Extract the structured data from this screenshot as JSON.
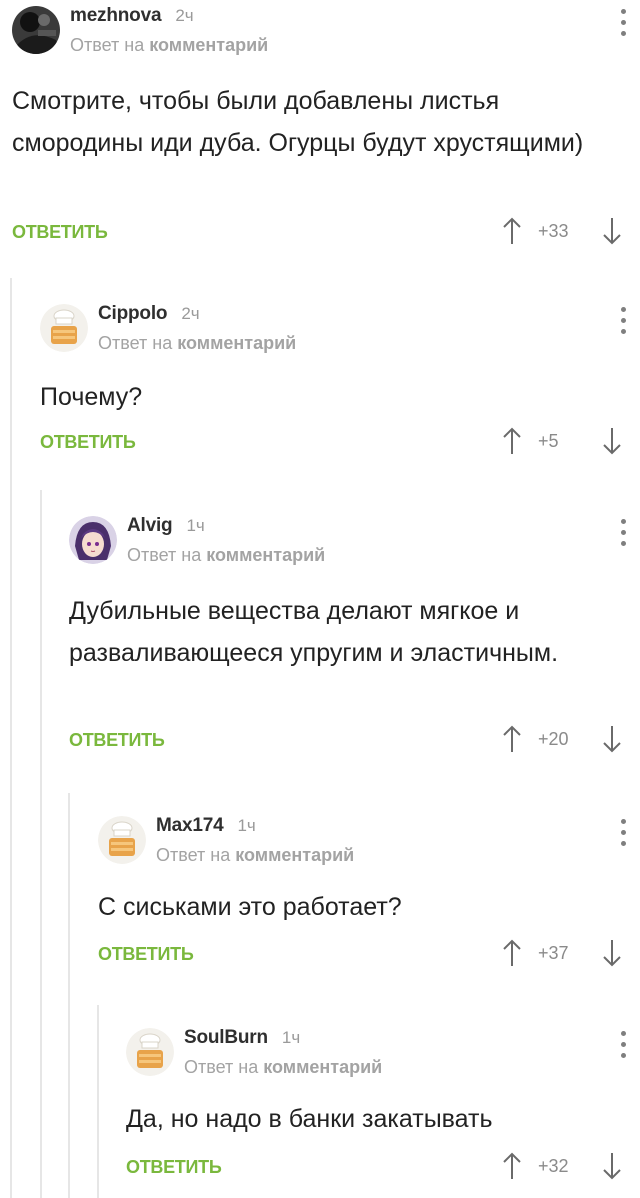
{
  "comments": [
    {
      "author": "mezhnova",
      "time": "2ч",
      "reply_prefix": "Ответ на",
      "reply_target": "комментарий",
      "text": "Смотрите, чтобы были добавлены листья смородины иди дуба. Огурцы будут хрустящими)",
      "reply_label": "ОТВЕТИТЬ",
      "score": "+33",
      "avatar": "dark-photo-avatar"
    },
    {
      "author": "Cippolo",
      "time": "2ч",
      "reply_prefix": "Ответ на",
      "reply_target": "комментарий",
      "text": "Почему?",
      "reply_label": "ОТВЕТИТЬ",
      "score": "+5",
      "avatar": "default-chef-avatar"
    },
    {
      "author": "Alvig",
      "time": "1ч",
      "reply_prefix": "Ответ на",
      "reply_target": "комментарий",
      "text": "Дубильные вещества делают мягкое и разваливающееся упругим и эластичным.",
      "reply_label": "ОТВЕТИТЬ",
      "score": "+20",
      "avatar": "anime-girl-avatar"
    },
    {
      "author": "Max174",
      "time": "1ч",
      "reply_prefix": "Ответ на",
      "reply_target": "комментарий",
      "text": "С сиськами это работает?",
      "reply_label": "ОТВЕТИТЬ",
      "score": "+37",
      "avatar": "default-chef-avatar"
    },
    {
      "author": "SoulBurn",
      "time": "1ч",
      "reply_prefix": "Ответ на",
      "reply_target": "комментарий",
      "text": "Да, но надо в банки закатывать",
      "reply_label": "ОТВЕТИТЬ",
      "score": "+32",
      "avatar": "default-chef-avatar"
    }
  ],
  "colors": {
    "reply_green": "#7ab83d",
    "thread_line": "#e6e6e6",
    "meta_gray": "#a3a3a3"
  }
}
